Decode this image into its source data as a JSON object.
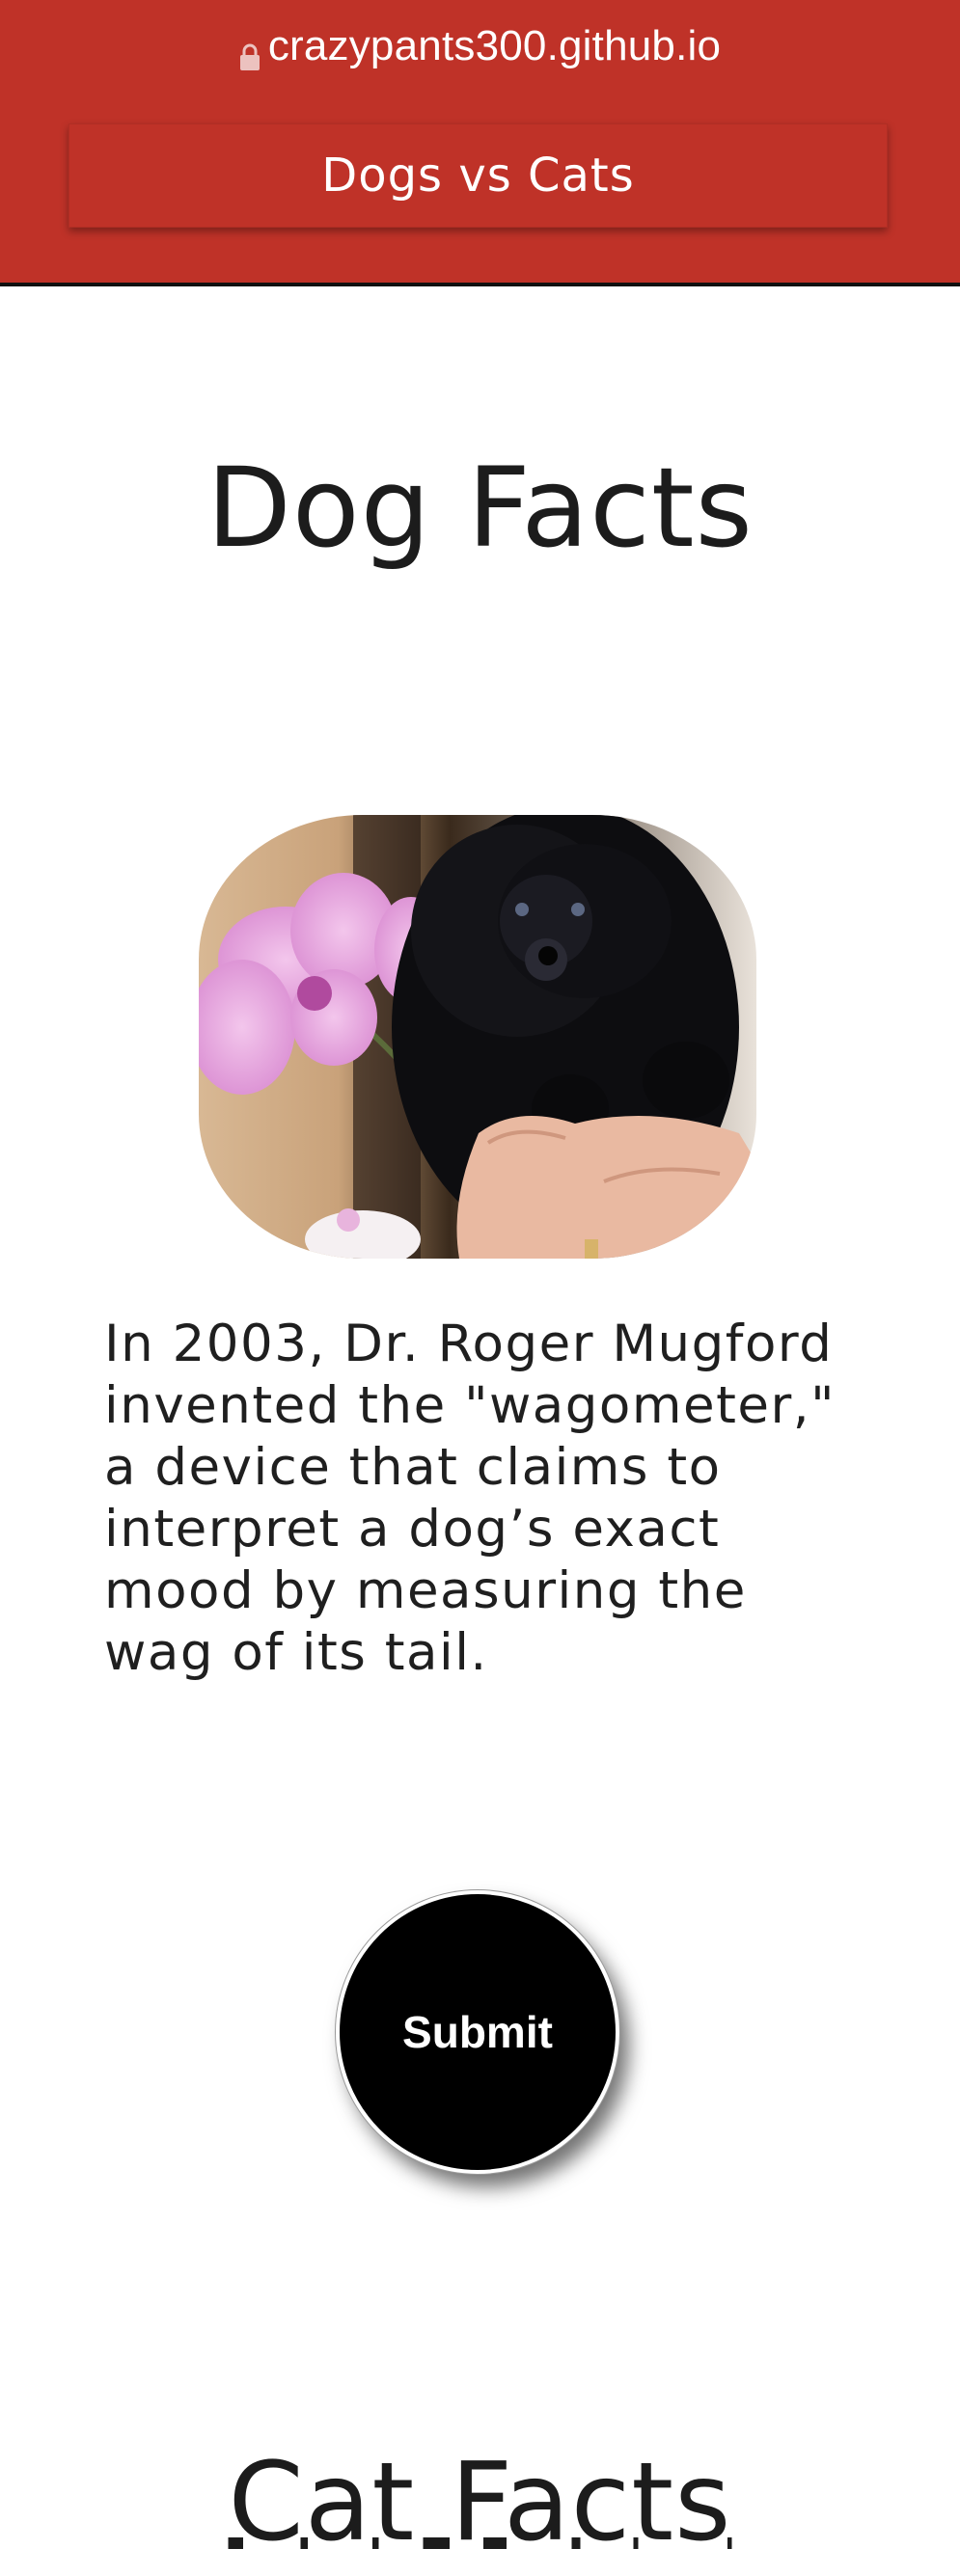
{
  "browser": {
    "url": "crazypants300.github.io",
    "lock_icon": "lock-icon"
  },
  "header": {
    "nav_label": "Dogs vs Cats",
    "background_color": "#bf3228"
  },
  "dog_section": {
    "title": "Dog Facts",
    "image_description": "black poodle puppy with pink orchid",
    "fact": "In 2003, Dr. Roger Mugford invented the \"wagometer,\" a device that claims to interpret a dog’s exact mood by measuring the wag of its tail."
  },
  "submit": {
    "label": "Submit"
  },
  "cat_section": {
    "title": "Cat Facts"
  }
}
